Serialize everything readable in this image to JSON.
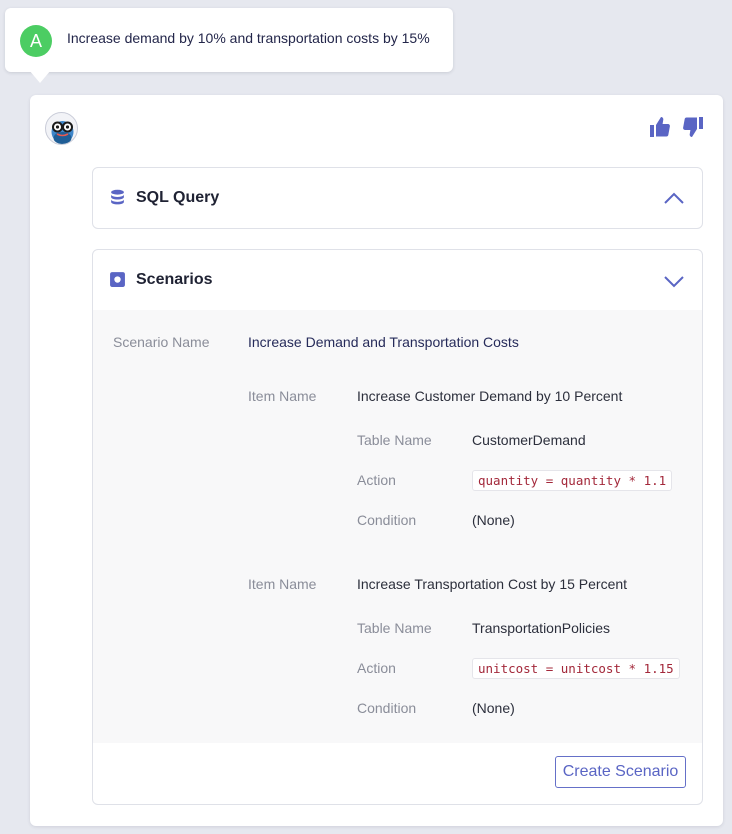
{
  "user_message": {
    "avatar_letter": "A",
    "text": "Increase demand by 10% and transportation costs by 15%"
  },
  "assistant": {
    "feedback": {
      "thumbs_up_icon": "thumbs-up-icon",
      "thumbs_down_icon": "thumbs-down-icon"
    },
    "sql_panel": {
      "title": "SQL Query",
      "icon": "database-icon",
      "state": "collapsed"
    },
    "scenarios_panel": {
      "title": "Scenarios",
      "icon": "square-dot-icon",
      "state": "expanded",
      "scenario_name_label": "Scenario Name",
      "scenario_name": "Increase Demand and Transportation Costs",
      "items": [
        {
          "item_label": "Item Name",
          "item_name": "Increase Customer Demand by 10 Percent",
          "table_label": "Table Name",
          "table_name": "CustomerDemand",
          "action_label": "Action",
          "action": "quantity = quantity * 1.1",
          "condition_label": "Condition",
          "condition": "(None)"
        },
        {
          "item_label": "Item Name",
          "item_name": "Increase Transportation Cost by 15 Percent",
          "table_label": "Table Name",
          "table_name": "TransportationPolicies",
          "action_label": "Action",
          "action": "unitcost = unitcost * 1.15",
          "condition_label": "Condition",
          "condition": "(None)"
        }
      ],
      "create_button": "Create Scenario"
    }
  },
  "colors": {
    "accent": "#5a65c4",
    "avatar_green": "#4ccd63",
    "code_red": "#a3283a",
    "background": "#e6e8ef"
  }
}
